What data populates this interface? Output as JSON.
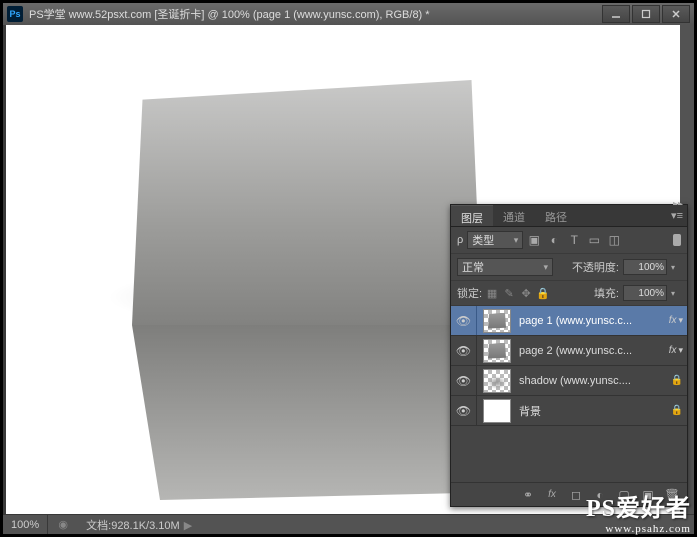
{
  "titlebar": {
    "app_icon": "Ps",
    "title": "PS学堂  www.52psxt.com [圣诞折卡] @ 100% (page 1 (www.yunsc.com), RGB/8) *"
  },
  "statusbar": {
    "zoom": "100%",
    "doc": "文档:928.1K/3.10M"
  },
  "panel": {
    "tabs": {
      "layers": "图层",
      "channels": "通道",
      "paths": "路径"
    },
    "filter_label": "类型",
    "blend_mode": "正常",
    "opacity_label": "不透明度:",
    "opacity_value": "100%",
    "lock_label": "锁定:",
    "fill_label": "填充:",
    "fill_value": "100%"
  },
  "layers": [
    {
      "name": "page 1 (www.yunsc.c...",
      "selected": true,
      "fx": true,
      "locked": false,
      "thumb": "folded"
    },
    {
      "name": "page 2 (www.yunsc.c...",
      "selected": false,
      "fx": true,
      "locked": false,
      "thumb": "folded"
    },
    {
      "name": "shadow (www.yunsc....",
      "selected": false,
      "fx": false,
      "locked": true,
      "thumb": "shadow"
    },
    {
      "name": "背景",
      "selected": false,
      "fx": false,
      "locked": true,
      "thumb": "white"
    }
  ],
  "watermark": {
    "big": "PS爱好者",
    "small": "www.psahz.com"
  }
}
